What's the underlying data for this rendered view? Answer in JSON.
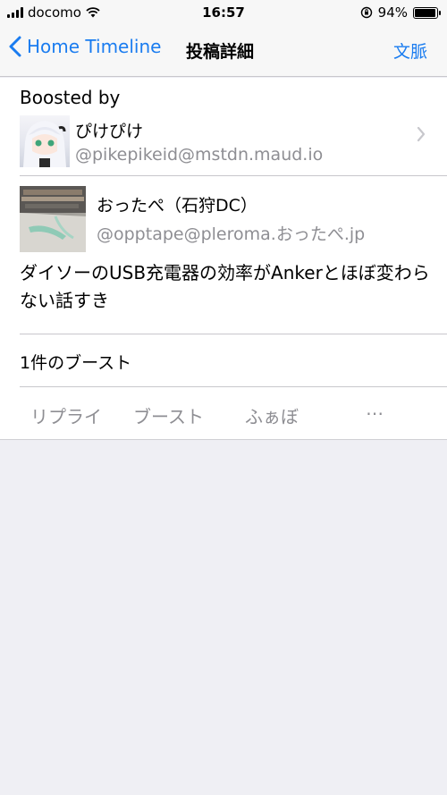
{
  "status_bar": {
    "carrier": "docomo",
    "time": "16:57",
    "battery": "94%",
    "battery_level": 0.94
  },
  "nav": {
    "back_label": "Home Timeline",
    "title": "投稿詳細",
    "right_label": "文脈"
  },
  "boosted": {
    "label": "Boosted by",
    "name": "ぴけぴけ",
    "handle": "@pikepikeid@mstdn.maud.io"
  },
  "post": {
    "author_name": "おったぺ（石狩DC）",
    "author_handle": "@opptape@pleroma.おったぺ.jp",
    "content": "ダイソーのUSB充電器の効率がAnkerとほぼ変わらない話すき",
    "boost_count": "1件のブースト"
  },
  "actions": {
    "reply": "リプライ",
    "boost": "ブースト",
    "favourite": "ふぁぼ",
    "more": "⋯"
  },
  "colors": {
    "accent": "#1a7cf0",
    "secondary_text": "#8e8e93",
    "background": "#efeff4"
  }
}
